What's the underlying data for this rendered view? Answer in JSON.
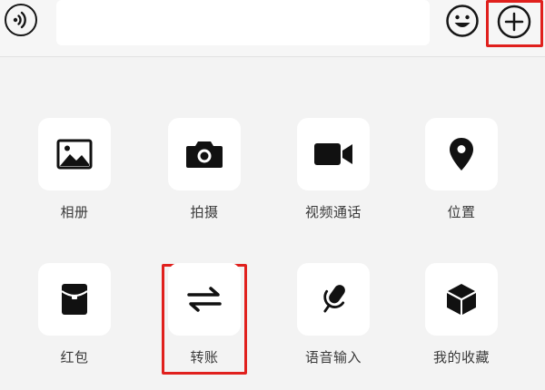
{
  "input_bar": {
    "voice_icon": "voice-icon",
    "message_value": "",
    "emoji_icon": "emoji-icon",
    "plus_icon": "plus-icon"
  },
  "panel": {
    "items": [
      {
        "label": "相册",
        "icon": "photo-icon"
      },
      {
        "label": "拍摄",
        "icon": "camera-icon"
      },
      {
        "label": "视频通话",
        "icon": "video-call-icon"
      },
      {
        "label": "位置",
        "icon": "location-icon"
      },
      {
        "label": "红包",
        "icon": "red-packet-icon"
      },
      {
        "label": "转账",
        "icon": "transfer-icon"
      },
      {
        "label": "语音输入",
        "icon": "microphone-icon"
      },
      {
        "label": "我的收藏",
        "icon": "favorites-icon"
      }
    ]
  },
  "colors": {
    "highlight": "#e0201d",
    "icon": "#111111",
    "tile": "#ffffff",
    "background": "#f3f3f3"
  }
}
